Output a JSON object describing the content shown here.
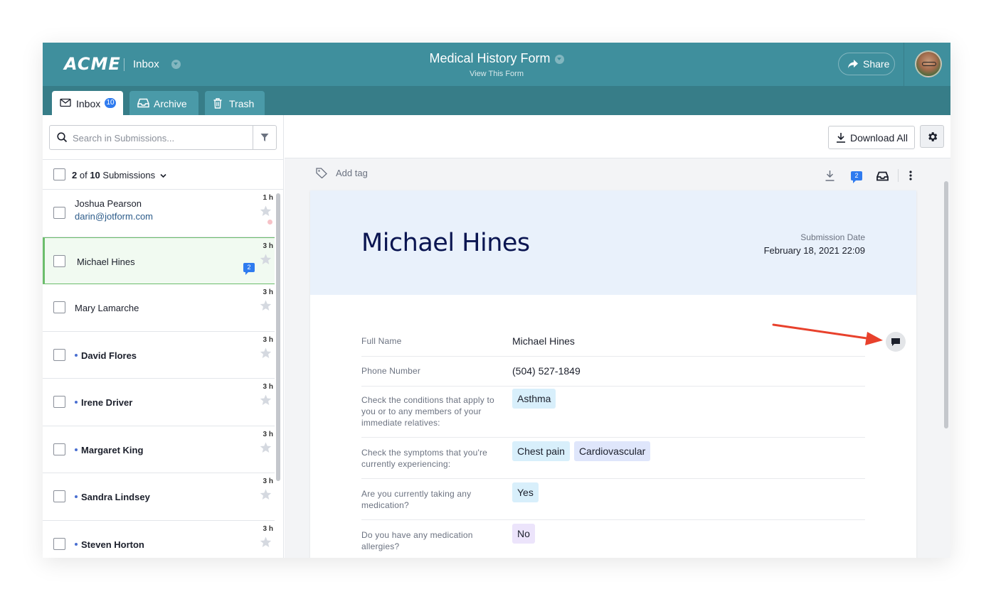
{
  "header": {
    "logo_text": "ACME",
    "inbox_label": "Inbox",
    "form_title": "Medical History Form",
    "view_form": "View This Form",
    "share_label": "Share"
  },
  "tabs": [
    {
      "label": "Inbox",
      "badge": "10"
    },
    {
      "label": "Archive"
    },
    {
      "label": "Trash"
    }
  ],
  "search": {
    "placeholder": "Search in Submissions..."
  },
  "list": {
    "count_selected": "2",
    "count_of": " of ",
    "count_total": "10",
    "count_suffix": " Submissions",
    "rows": [
      {
        "name": "Joshua Pearson",
        "email": "darin@jotform.com",
        "time": "1 h"
      },
      {
        "name": "Michael Hines",
        "time": "3 h",
        "comments": "2"
      },
      {
        "name": "Mary Lamarche",
        "time": "3 h"
      },
      {
        "name": "David Flores",
        "time": "3 h"
      },
      {
        "name": "Irene Driver",
        "time": "3 h"
      },
      {
        "name": "Margaret King",
        "time": "3 h"
      },
      {
        "name": "Sandra Lindsey",
        "time": "3 h"
      },
      {
        "name": "Steven Horton",
        "time": "3 h"
      }
    ]
  },
  "toolbar": {
    "download_all": "Download All"
  },
  "detail": {
    "add_tag": "Add tag",
    "comment_count": "2",
    "name": "Michael Hines",
    "date_label": "Submission Date",
    "date": "February 18, 2021 22:09",
    "fields": [
      {
        "label": "Full Name",
        "value": "Michael Hines"
      },
      {
        "label": "Phone Number",
        "value": "(504) 527-1849"
      },
      {
        "label": "Check the conditions that apply to you or to any members of your immediate relatives:",
        "chips": [
          "Asthma"
        ]
      },
      {
        "label": "Check the symptoms that you're currently experiencing:",
        "chips": [
          "Chest pain",
          "Cardiovascular"
        ]
      },
      {
        "label": "Are you currently taking any medication?",
        "chips": [
          "Yes"
        ]
      },
      {
        "label": "Do you have any medication allergies?",
        "chips": [
          "No"
        ]
      }
    ]
  },
  "colors": {
    "header": "#3f8f9d",
    "tabbar": "#377d88",
    "accent_blue": "#2f7bef",
    "selected_border": "#6cbd6c",
    "arrow": "#e8412c"
  },
  "icons": [
    "envelope-icon",
    "archive-tray-icon",
    "trash-icon",
    "search-icon",
    "filter-icon",
    "star-icon",
    "download-icon",
    "gear-icon",
    "tag-icon",
    "comment-icon",
    "more-vertical-icon",
    "share-arrow-icon"
  ]
}
